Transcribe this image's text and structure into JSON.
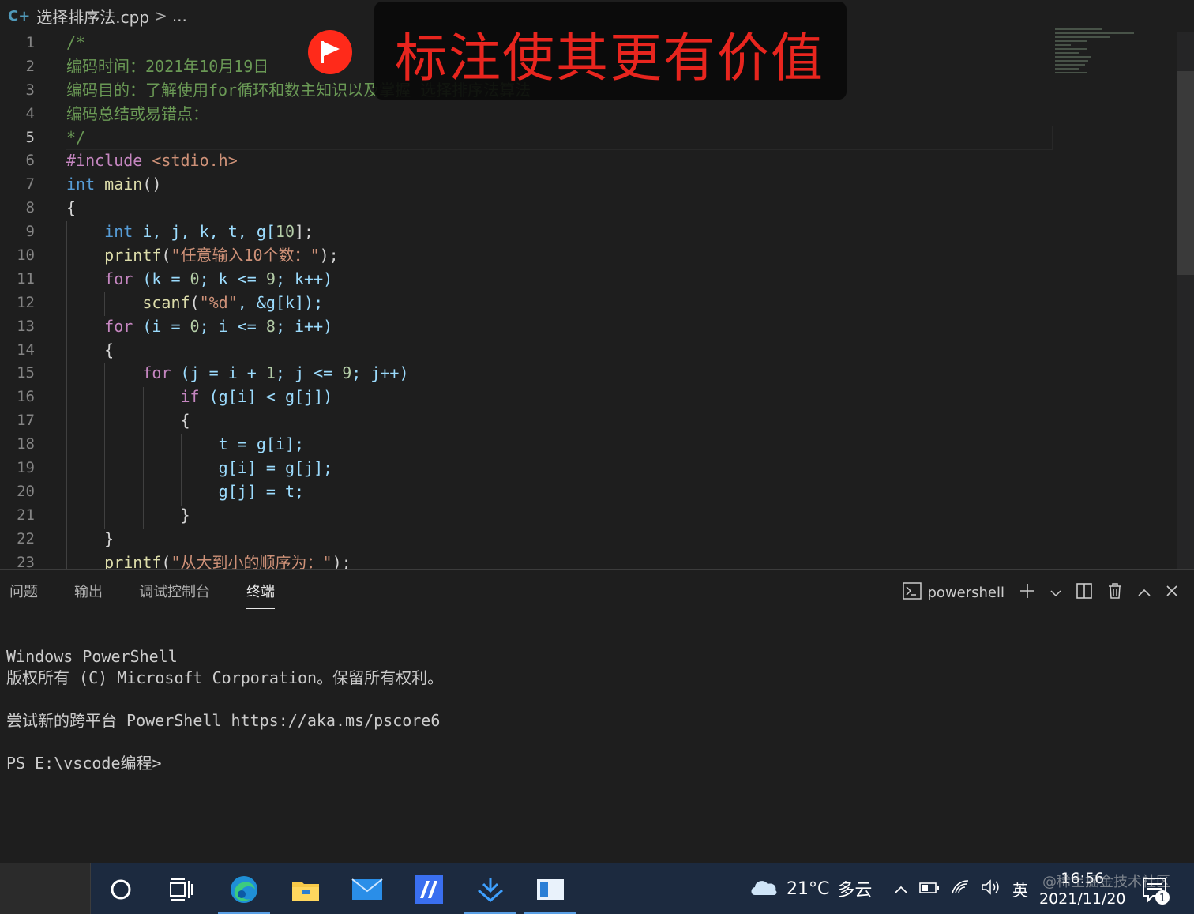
{
  "breadcrumb": {
    "file": "选择排序法.cpp",
    "sep": ">",
    "more": "..."
  },
  "editor": {
    "current_line": 5,
    "lines": [
      "1",
      "2",
      "3",
      "4",
      "5",
      "6",
      "7",
      "8",
      "9",
      "10",
      "11",
      "12",
      "13",
      "14",
      "15",
      "16",
      "17",
      "18",
      "19",
      "20",
      "21",
      "22",
      "23"
    ],
    "code": {
      "l1": "/*",
      "l2": "编码时间：2021年10月19日",
      "l3": "编码目的：了解使用for循环和数主知识以及掌握 选择排序法算法",
      "l4": "编码总结或易错点：",
      "l5": "*/",
      "l6_inc": "#include",
      "l6_hdr": " <stdio.h>",
      "l7_kw": "int",
      "l7_fn": " main",
      "l7_rest": "()",
      "l8": "{",
      "l9_kw": "int",
      "l9_rest": " i, j, k, t, g[",
      "l9_num": "10",
      "l9_end": "];",
      "l10_fn": "printf",
      "l10_str": "\"任意输入10个数：\"",
      "l10_end": ");",
      "l11_kw": "for",
      "l11_rest": " (k = ",
      "l11_n1": "0",
      "l11_mid": "; k <= ",
      "l11_n2": "9",
      "l11_end": "; k++)",
      "l12_fn": "scanf",
      "l12_str": "\"%d\"",
      "l12_end": ", &g[k]);",
      "l13_kw": "for",
      "l13_rest": " (i = ",
      "l13_n1": "0",
      "l13_mid": "; i <= ",
      "l13_n2": "8",
      "l13_end": "; i++)",
      "l14": "{",
      "l15_kw": "for",
      "l15_rest": " (j = i + ",
      "l15_n1": "1",
      "l15_mid": "; j <= ",
      "l15_n2": "9",
      "l15_end": "; j++)",
      "l16_kw": "if",
      "l16_rest": " (g[i] < g[j])",
      "l17": "{",
      "l18": "t = g[i];",
      "l19": "g[i] = g[j];",
      "l20": "g[j] = t;",
      "l21": "}",
      "l22": "}",
      "l23_fn": "printf",
      "l23_str": "\"从大到小的顺序为：\"",
      "l23_end": ");"
    }
  },
  "overlay": {
    "text": "标注使其更有价值"
  },
  "panel": {
    "tabs": [
      "问题",
      "输出",
      "调试控制台",
      "终端"
    ],
    "active_tab": "终端",
    "shell": "powershell",
    "terminal": {
      "l1": "Windows PowerShell",
      "l2": "版权所有 (C) Microsoft Corporation。保留所有权利。",
      "l3": "尝试新的跨平台 PowerShell https://aka.ms/pscore6",
      "l4": "PS E:\\vscode编程>"
    }
  },
  "taskbar": {
    "weather_temp": "21°C",
    "weather_desc": "多云",
    "ime": "英",
    "time": "16:56",
    "date": "2021/11/20",
    "notification_count": "1",
    "watermark": "@稀土掘金技术社区"
  }
}
